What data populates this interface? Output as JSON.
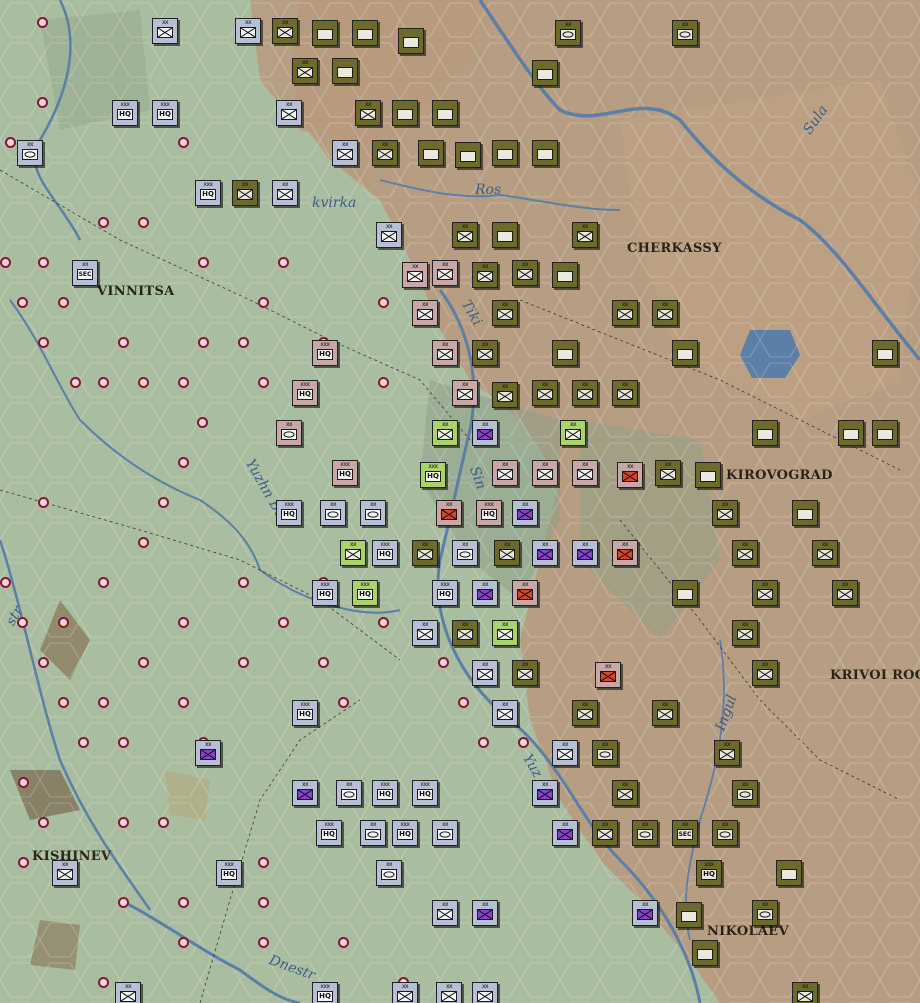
{
  "map": {
    "cities": [
      {
        "name": "VINNITSA"
      },
      {
        "name": "CHERKASSY"
      },
      {
        "name": "KIROVOGRAD"
      },
      {
        "name": "KRIVOI ROG"
      },
      {
        "name": "KISHINEV"
      },
      {
        "name": "NIKOLAEV"
      }
    ],
    "rivers": [
      {
        "name": "Sula"
      },
      {
        "name": "Ros"
      },
      {
        "name": "kvirka"
      },
      {
        "name": "Tiki"
      },
      {
        "name": "Sin"
      },
      {
        "name": "Yuzhn Bug"
      },
      {
        "name": "Ingul"
      },
      {
        "name": "Yuz"
      },
      {
        "name": "Dnestr"
      },
      {
        "name": "str"
      }
    ]
  },
  "counter_labels": {
    "hq": "HQ",
    "sec": "SEC",
    "size_xx": "xx",
    "size_xxx": "xxx",
    "size_x": "x"
  },
  "colors": {
    "axis": "#6d6a2b",
    "soviet": "#b7bfd6",
    "soviet_armor": "#8a3fd0",
    "soviet_red": "#c9a7a7",
    "marker": "#8a1530",
    "terrain_plain": "#a8bf9f",
    "terrain_steppe": "#b9957c",
    "water": "#5b7fa6"
  }
}
